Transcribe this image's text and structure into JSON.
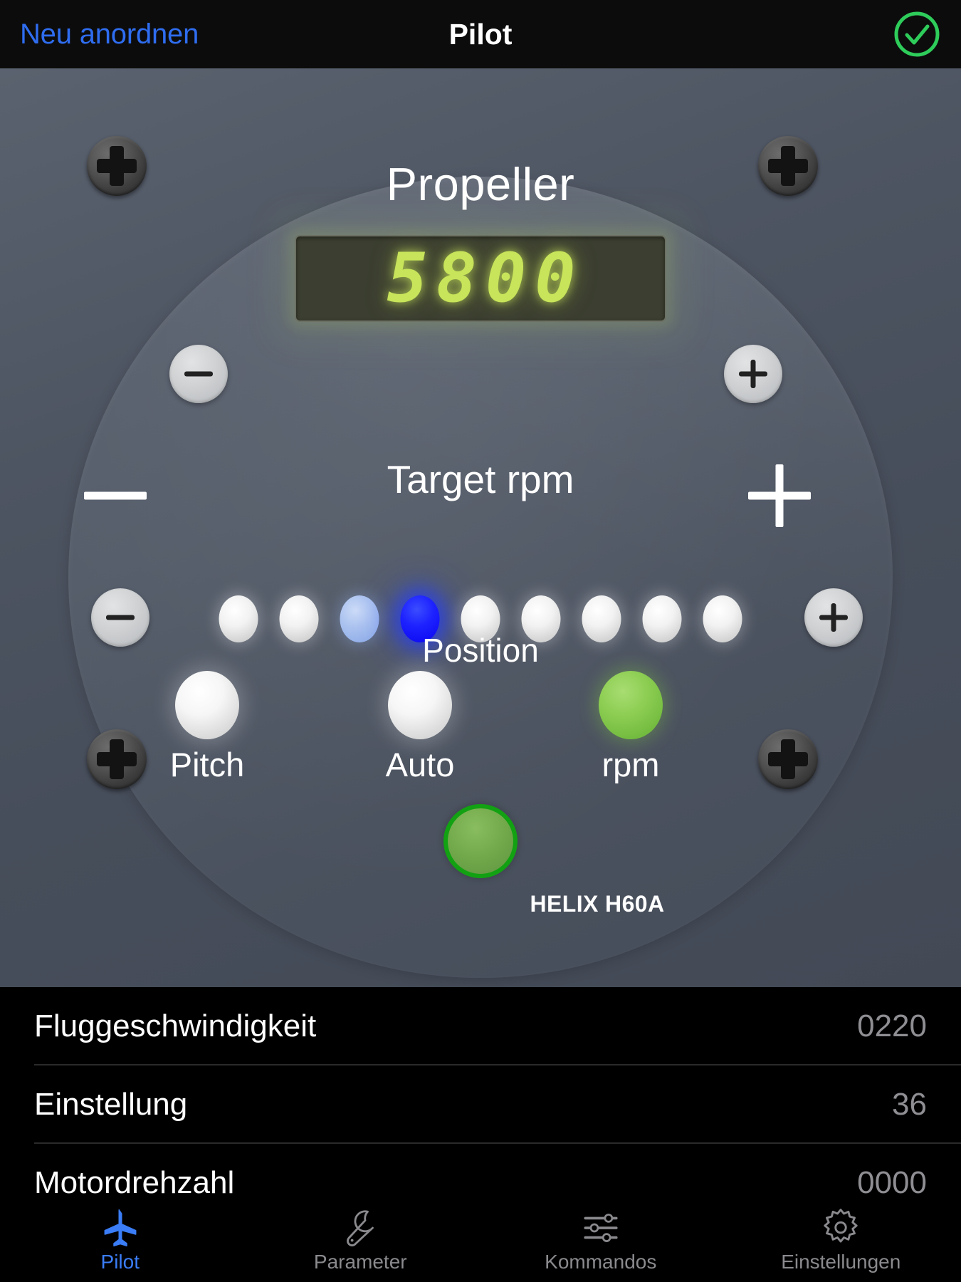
{
  "navbar": {
    "left_button": "Neu anordnen",
    "title": "Pilot",
    "right_icon": "check-circle-icon",
    "right_icon_color": "#2ecc5a",
    "left_color": "#2f6df0"
  },
  "panel": {
    "title": "Propeller",
    "display": {
      "value": "5800",
      "glow_color": "#c7e45a",
      "background": "#3b3e30"
    },
    "target": {
      "label": "Target rpm",
      "minus_label": "−",
      "plus_label": "+"
    },
    "position": {
      "label": "Position",
      "led_count": 9,
      "active_index": 3,
      "dim_index": 2,
      "active_color": "#1d22ff",
      "dim_color": "#8aa9e6",
      "off_color": "#f2f2f2"
    },
    "modes": [
      {
        "label": "Pitch",
        "state": "off",
        "color": "#f6f6f6"
      },
      {
        "label": "Auto",
        "state": "off",
        "color": "#f6f6f6"
      },
      {
        "label": "rpm",
        "state": "on",
        "color": "#8ccd52"
      }
    ],
    "push_button": {
      "name": "start-button",
      "fill": "#74ab4c",
      "ring": "#12a112"
    },
    "model": "HELIX H60A",
    "screws": [
      "screw-top-left",
      "screw-top-right",
      "screw-bottom-left",
      "screw-bottom-right"
    ]
  },
  "list": {
    "rows": [
      {
        "label": "Fluggeschwindigkeit",
        "value": "0220"
      },
      {
        "label": "Einstellung",
        "value": "36"
      },
      {
        "label": "Motordrehzahl",
        "value": "0000"
      }
    ]
  },
  "tabbar": {
    "active_color": "#3b7df6",
    "inactive_color": "#8a8a8e",
    "tabs": [
      {
        "label": "Pilot",
        "icon": "airplane-icon",
        "active": true
      },
      {
        "label": "Parameter",
        "icon": "wrench-icon",
        "active": false
      },
      {
        "label": "Kommandos",
        "icon": "sliders-icon",
        "active": false
      },
      {
        "label": "Einstellungen",
        "icon": "gear-icon",
        "active": false
      }
    ]
  }
}
